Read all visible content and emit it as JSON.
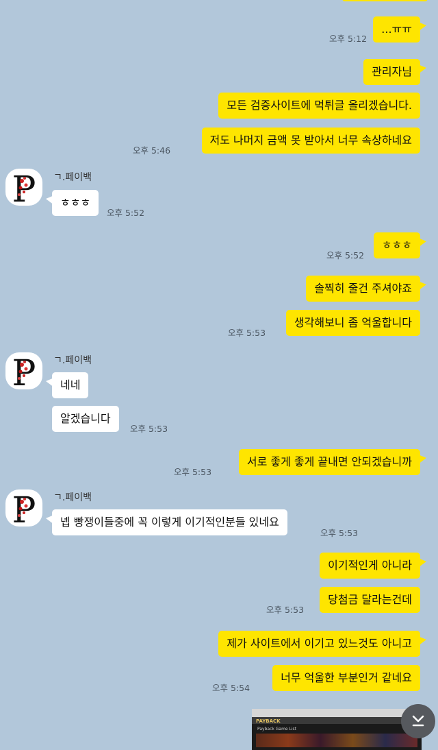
{
  "messages": {
    "m1": "...ㅠㅠ",
    "m1_time": "오후 5:12",
    "m2": "관리자님",
    "m3": "모든 검증사이트에 먹튀글 올리겠습니다.",
    "m4": "저도 나머지 금액 못 받아서 너무 속상하네요",
    "m4_time": "오후 5:46",
    "sender1": "ㄱ.페이백",
    "m5": "ㅎㅎㅎ",
    "m5_time": "오후 5:52",
    "m6": "ㅎㅎㅎ",
    "m6_time": "오후 5:52",
    "m7": "솔찍히 줄건 주셔야죠",
    "m8": "생각해보니 좀 억울합니다",
    "m8_time": "오후 5:53",
    "sender2": "ㄱ.페이백",
    "m9": "네네",
    "m10": "알겠습니다",
    "m10_time": "오후 5:53",
    "m11": "서로 좋게 좋게 끝내면 안되겠습니까",
    "m11_time": "오후 5:53",
    "sender3": "ㄱ.페이백",
    "m12": "넵 빵쟁이들중에 꼭 이렇게 이기적인분들 있네요",
    "m12_time": "오후 5:53",
    "m13": "이기적인게 아니라",
    "m14": "당첨금 달라는건데",
    "m14_time": "오후 5:53",
    "m15": "제가 사이트에서 이기고 있느것도 아니고",
    "m16": "너무 억울한 부분인거 같네요",
    "m16_time": "오후 5:54"
  },
  "thumbnail": {
    "brand": "PAYBACK",
    "subtitle": "Payback Game List"
  },
  "avatar_letter": "P",
  "colors": {
    "background": "#b2c7da",
    "outgoing_bubble": "#fee500",
    "incoming_bubble": "#ffffff"
  },
  "icons": {
    "scroll_down": "chevron-double-down-icon"
  }
}
